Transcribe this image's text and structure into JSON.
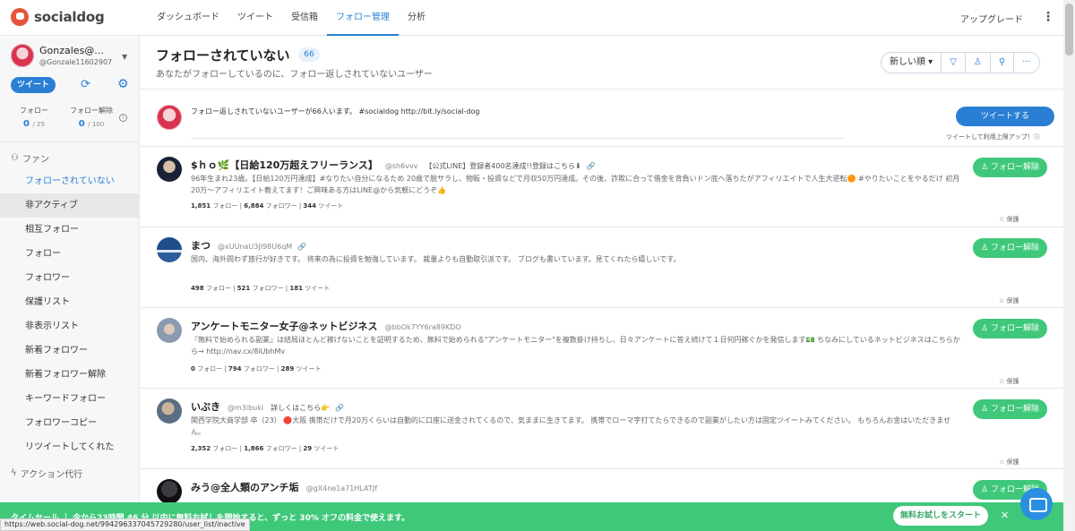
{
  "app": {
    "logo": "socialdog"
  },
  "nav": [
    {
      "label": "ダッシュボード"
    },
    {
      "label": "ツイート"
    },
    {
      "label": "受信箱"
    },
    {
      "label": "フォロー管理"
    },
    {
      "label": "分析"
    }
  ],
  "header": {
    "upgrade": "アップグレード",
    "more": "⋮"
  },
  "account": {
    "name": "Gonzales@...",
    "handle": "@Gonzale11602907"
  },
  "sidebar": {
    "tweet_button": "ツイート",
    "stats": [
      {
        "label": "フォロー",
        "value": "0",
        "max": "/ 25"
      },
      {
        "label": "フォロー解除",
        "value": "0",
        "max": "/ 100"
      }
    ],
    "fan_section": "ファン",
    "items": [
      {
        "label": "フォローされていない"
      },
      {
        "label": "非アクティブ"
      },
      {
        "label": "相互フォロー"
      },
      {
        "label": "フォロー"
      },
      {
        "label": "フォロワー"
      },
      {
        "label": "保護リスト"
      },
      {
        "label": "非表示リスト"
      },
      {
        "label": "新着フォロワー"
      },
      {
        "label": "新着フォロワー解除"
      },
      {
        "label": "キーワードフォロー"
      },
      {
        "label": "フォロワーコピー"
      },
      {
        "label": "リツイートしてくれた"
      }
    ],
    "action_section": "アクション代行"
  },
  "page": {
    "title": "フォローされていない",
    "count": "66",
    "subtitle": "あなたがフォローしているのに、フォロー返しされていないユーザー",
    "sort": "新しい順 ▾",
    "tool_more": "···"
  },
  "compose": {
    "text": "フォロー返しされていないユーザーが66人います。 #socialdog http://bit.ly/social-dog",
    "button": "ツイートする",
    "note": "ツイートして利用上限アップ！ⓘ"
  },
  "users": [
    {
      "name": "$ｈｏ🌿【日給120万超えフリーランス】",
      "handle": "@sh6vvv",
      "extra": "【公式LINE】登録者400名達成!!登録はこちら⬇",
      "bio": "96年生まれ23歳。【日給120万円達成】#なりたい自分になるため 20歳で脱サラし、物販・投資などで月収50万円達成。その後、詐欺に合って借金を背負いドン底へ落ちたがアフィリエイトで人生大逆転🟠 #やりたいことをやるだけ 初月20万〜アフィリエイト教えてます！ご興味ある方はLINE@から気軽にどうぞ👍",
      "following": "1,851",
      "followers": "6,884",
      "tweets": "344"
    },
    {
      "name": "まつ",
      "handle": "@xUUnaU3JI98U6qM",
      "extra": "",
      "bio": "国内、海外問わず旅行が好きです。 将来の為に投資を勉強しています。 裁量よりも自動取引派です。 ブログも書いています。見てくれたら嬉しいです。",
      "following": "498",
      "followers": "521",
      "tweets": "181"
    },
    {
      "name": "アンケートモニター女子@ネットビジネス",
      "handle": "@bbOk7YY6ra89KDO",
      "extra": "",
      "bio": "『無料で始められる副業』は结局ほとんど稼げないことを証明するため、無料で始められる\"アンケートモニター\"を複数掛け持ちし、日々アンケートに答え続けて１日何円稼ぐかを発信します💵 ちなみにしているネットビジネスはこちらから→ http://nav.cx/8iUbhMv",
      "following": "0",
      "followers": "794",
      "tweets": "289"
    },
    {
      "name": "いぶき",
      "handle": "@m3ibuki",
      "extra": "詳しくはこちら👉",
      "bio": "関西学院大商学部 卒（23） 🔴大阪 携帯だけで月20万くらいは自動的に口座に送金されてくるので、気ままに生きてます。 携帯でローマ字打てたらできるので副業がしたい方は固定ツイートみてください。 もちろんお金はいただきません。",
      "following": "2,352",
      "followers": "1,866",
      "tweets": "29"
    },
    {
      "name": "みう@全人類のアンチ垢",
      "handle": "@gX4ne1a71HLATJf",
      "extra": "",
      "bio": "",
      "following": "",
      "followers": "",
      "tweets": ""
    }
  ],
  "labels": {
    "following": "フォロー",
    "followers": "フォロワー",
    "tweets": "ツイート",
    "unfollow": "フォロー解除",
    "protect": "☆ 保護"
  },
  "banner": {
    "text": "タイムセール ｜ 今から23時間 46 分 以内に無料お試しを開始すると、ずっと 30% オフの料金で使えます。",
    "button": "無料お試しをスタート",
    "close": "✕"
  },
  "status_url": "https://web.social-dog.net/994296337045729280/user_list/inactive",
  "colors": {
    "accent": "#2a7fd4",
    "green": "#3fc87a",
    "logo": "#e6543b"
  }
}
